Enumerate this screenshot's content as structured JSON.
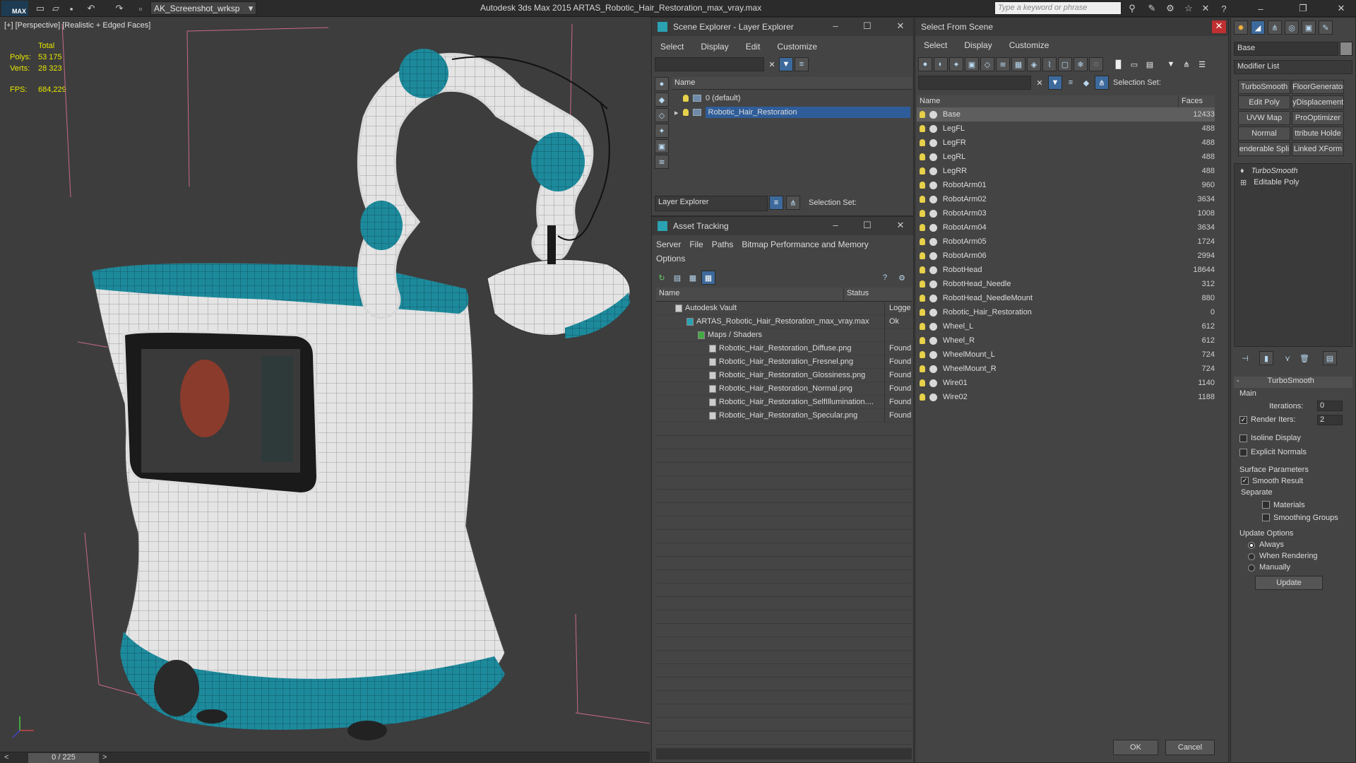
{
  "titlebar": {
    "app_logo": "MAX",
    "workspace": "AK_Screenshot_wrksp",
    "title": "Autodesk 3ds Max  2015     ARTAS_Robotic_Hair_Restoration_max_vray.max",
    "search_placeholder": "Type a keyword or phrase"
  },
  "viewport": {
    "label": "[+] [Perspective] [Realistic + Edged Faces]",
    "stats": {
      "total_label": "Total",
      "polys_label": "Polys:",
      "polys_value": "53 175",
      "verts_label": "Verts:",
      "verts_value": "28 323",
      "fps_label": "FPS:",
      "fps_value": "684,229"
    }
  },
  "timeline": {
    "frame": "0 / 225"
  },
  "scene_explorer": {
    "title": "Scene Explorer - Layer Explorer",
    "menu": [
      "Select",
      "Display",
      "Edit",
      "Customize"
    ],
    "column_name": "Name",
    "layers": [
      "0 (default)",
      "Robotic_Hair_Restoration"
    ],
    "footer_label": "Layer Explorer",
    "selection_set_label": "Selection Set:"
  },
  "asset_tracking": {
    "title": "Asset Tracking",
    "menu": [
      "Server",
      "File",
      "Paths",
      "Bitmap Performance and Memory"
    ],
    "menu2": "Options",
    "col_name": "Name",
    "col_status": "Status",
    "rows": [
      {
        "name": "Autodesk Vault",
        "status": "Logge"
      },
      {
        "name": "ARTAS_Robotic_Hair_Restoration_max_vray.max",
        "status": "Ok"
      },
      {
        "name": "Maps / Shaders",
        "status": ""
      },
      {
        "name": "Robotic_Hair_Restoration_Diffuse.png",
        "status": "Found"
      },
      {
        "name": "Robotic_Hair_Restoration_Fresnel.png",
        "status": "Found"
      },
      {
        "name": "Robotic_Hair_Restoration_Glossiness.png",
        "status": "Found"
      },
      {
        "name": "Robotic_Hair_Restoration_Normal.png",
        "status": "Found"
      },
      {
        "name": "Robotic_Hair_Restoration_SelfIllumination....",
        "status": "Found"
      },
      {
        "name": "Robotic_Hair_Restoration_Specular.png",
        "status": "Found"
      }
    ]
  },
  "select_from_scene": {
    "title": "Select From Scene",
    "menu": [
      "Select",
      "Display",
      "Customize"
    ],
    "selection_set_label": "Selection Set:",
    "col_name": "Name",
    "col_faces": "Faces",
    "objects": [
      {
        "name": "Base",
        "faces": "12433"
      },
      {
        "name": "LegFL",
        "faces": "488"
      },
      {
        "name": "LegFR",
        "faces": "488"
      },
      {
        "name": "LegRL",
        "faces": "488"
      },
      {
        "name": "LegRR",
        "faces": "488"
      },
      {
        "name": "RobotArm01",
        "faces": "960"
      },
      {
        "name": "RobotArm02",
        "faces": "3634"
      },
      {
        "name": "RobotArm03",
        "faces": "1008"
      },
      {
        "name": "RobotArm04",
        "faces": "3634"
      },
      {
        "name": "RobotArm05",
        "faces": "1724"
      },
      {
        "name": "RobotArm06",
        "faces": "2994"
      },
      {
        "name": "RobotHead",
        "faces": "18644"
      },
      {
        "name": "RobotHead_Needle",
        "faces": "312"
      },
      {
        "name": "RobotHead_NeedleMount",
        "faces": "880"
      },
      {
        "name": "Robotic_Hair_Restoration",
        "faces": "0"
      },
      {
        "name": "Wheel_L",
        "faces": "612"
      },
      {
        "name": "Wheel_R",
        "faces": "612"
      },
      {
        "name": "WheelMount_L",
        "faces": "724"
      },
      {
        "name": "WheelMount_R",
        "faces": "724"
      },
      {
        "name": "Wire01",
        "faces": "1140"
      },
      {
        "name": "Wire02",
        "faces": "1188"
      }
    ],
    "ok": "OK",
    "cancel": "Cancel"
  },
  "command_panel": {
    "object_name": "Base",
    "modifier_list": "Modifier List",
    "modifier_buttons": [
      "TurboSmooth",
      "FloorGenerator",
      "Edit Poly",
      "yDisplacement",
      "UVW Map",
      "ProOptimizer",
      "Normal",
      "ttribute Holde",
      "enderable Spli",
      "Linked XForm"
    ],
    "stack": [
      "TurboSmooth",
      "Editable Poly"
    ],
    "rollout_title": "TurboSmooth",
    "main_label": "Main",
    "iterations_label": "Iterations:",
    "iterations_value": "0",
    "render_iters_label": "Render Iters:",
    "render_iters_value": "2",
    "isoline": "Isoline Display",
    "explicit_normals": "Explicit Normals",
    "surface_params": "Surface Parameters",
    "smooth_result": "Smooth Result",
    "separate": "Separate",
    "materials": "Materials",
    "smoothing_groups": "Smoothing Groups",
    "update_options": "Update Options",
    "always": "Always",
    "when_rendering": "When Rendering",
    "manually": "Manually",
    "update": "Update"
  }
}
